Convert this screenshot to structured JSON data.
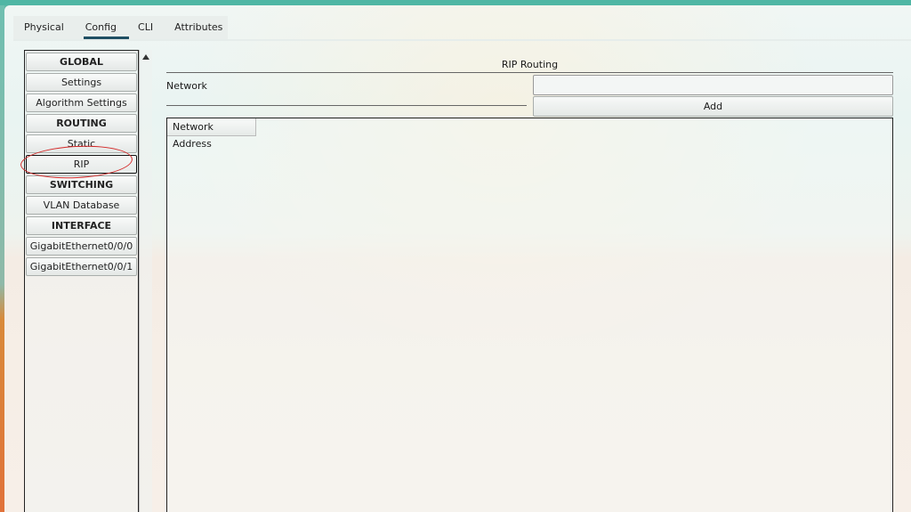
{
  "tabs": [
    "Physical",
    "Config",
    "CLI",
    "Attributes"
  ],
  "active_tab": "Config",
  "sidebar": {
    "items": [
      {
        "label": "GLOBAL",
        "type": "header"
      },
      {
        "label": "Settings",
        "type": "item"
      },
      {
        "label": "Algorithm Settings",
        "type": "item"
      },
      {
        "label": "ROUTING",
        "type": "header"
      },
      {
        "label": "Static",
        "type": "item"
      },
      {
        "label": "RIP",
        "type": "item",
        "selected": true
      },
      {
        "label": "SWITCHING",
        "type": "header"
      },
      {
        "label": "VLAN Database",
        "type": "item"
      },
      {
        "label": "INTERFACE",
        "type": "header"
      },
      {
        "label": "GigabitEthernet0/0/0",
        "type": "item"
      },
      {
        "label": "GigabitEthernet0/0/1",
        "type": "item"
      }
    ]
  },
  "main": {
    "section_title": "RIP Routing",
    "network_label": "Network",
    "network_value": "",
    "add_button_label": "Add",
    "list_header": "Network Address",
    "list_rows": []
  },
  "colors": {
    "tab_underline": "#1f4f63",
    "annotation_circle": "#d42a2a"
  }
}
